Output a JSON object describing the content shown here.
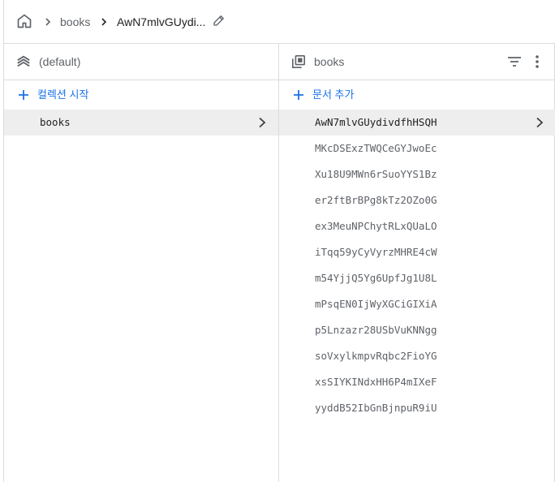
{
  "breadcrumb": {
    "home_icon": "home-icon",
    "items": [
      "books",
      "AwN7mlvGUydi..."
    ],
    "edit_icon": "pencil-icon"
  },
  "left_panel": {
    "header_title": "(default)",
    "header_icon": "database-icon",
    "add_label": "컬렉션 시작",
    "items": [
      "books"
    ]
  },
  "right_panel": {
    "header_title": "books",
    "header_icon": "collection-icon",
    "add_label": "문서 추가",
    "documents": [
      "AwN7mlvGUydivdfhHSQH",
      "MKcDSExzTWQCeGYJwoEc",
      "Xu18U9MWn6rSuoYYS1Bz",
      "er2ftBrBPg8kTz2OZo0G",
      "ex3MeuNPChytRLxQUaLO",
      "iTqq59yCyVyrzMHRE4cW",
      "m54YjjQ5Yg6UpfJg1U8L",
      "mPsqEN0IjWyXGCiGIXiA",
      "p5Lnzazr28USbVuKNNgg",
      "soVxylkmpvRqbc2FioYG",
      "xsSIYKINdxHH6P4mIXeF",
      "yyddB52IbGnBjnpuR9iU"
    ]
  },
  "colors": {
    "accent": "#1a73e8",
    "border": "#dadce0",
    "selected_bg": "#eeeeee"
  }
}
